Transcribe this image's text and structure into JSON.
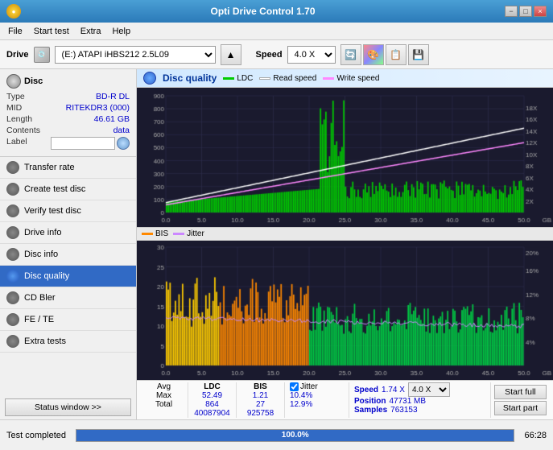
{
  "window": {
    "title": "Opti Drive Control 1.70",
    "icon": "disc-icon"
  },
  "titlebar": {
    "minimize_label": "−",
    "maximize_label": "□",
    "close_label": "×"
  },
  "menu": {
    "items": [
      "File",
      "Start test",
      "Extra",
      "Help"
    ]
  },
  "drive": {
    "label": "Drive",
    "value": "(E:)  ATAPI iHBS212  2.5L09",
    "speed_label": "Speed",
    "speed_value": "4.0 X"
  },
  "disc": {
    "header": "Disc",
    "type_label": "Type",
    "type_value": "BD-R DL",
    "mid_label": "MID",
    "mid_value": "RITEKDR3 (000)",
    "length_label": "Length",
    "length_value": "46.61 GB",
    "contents_label": "Contents",
    "contents_value": "data",
    "label_label": "Label",
    "label_value": ""
  },
  "nav": {
    "items": [
      {
        "id": "transfer-rate",
        "label": "Transfer rate",
        "active": false
      },
      {
        "id": "create-test",
        "label": "Create test disc",
        "active": false
      },
      {
        "id": "verify-test",
        "label": "Verify test disc",
        "active": false
      },
      {
        "id": "drive-info",
        "label": "Drive info",
        "active": false
      },
      {
        "id": "disc-info",
        "label": "Disc info",
        "active": false
      },
      {
        "id": "disc-quality",
        "label": "Disc quality",
        "active": true
      },
      {
        "id": "cd-bler",
        "label": "CD Bler",
        "active": false
      },
      {
        "id": "fe-te",
        "label": "FE / TE",
        "active": false
      },
      {
        "id": "extra-tests",
        "label": "Extra tests",
        "active": false
      }
    ]
  },
  "status_btn": "Status window >>",
  "chart": {
    "title": "Disc quality",
    "legend": [
      {
        "id": "ldc",
        "label": "LDC",
        "color": "#00aa00"
      },
      {
        "id": "read-speed",
        "label": "Read speed",
        "color": "#ffffff"
      },
      {
        "id": "write-speed",
        "label": "Write speed",
        "color": "#ff88ff"
      }
    ],
    "legend2": [
      {
        "id": "bis",
        "label": "BIS",
        "color": "#ff8800"
      },
      {
        "id": "jitter",
        "label": "Jitter",
        "color": "#cc88ff"
      }
    ]
  },
  "stats": {
    "headers": [
      "LDC",
      "BIS"
    ],
    "jitter_label": "Jitter",
    "jitter_checked": true,
    "speed_label": "Speed",
    "speed_value": "1.74 X",
    "speed_select": "4.0 X",
    "avg_label": "Avg",
    "avg_ldc": "52.49",
    "avg_bis": "1.21",
    "avg_jitter": "10.4%",
    "max_label": "Max",
    "max_ldc": "864",
    "max_bis": "27",
    "max_jitter": "12.9%",
    "total_label": "Total",
    "total_ldc": "40087904",
    "total_bis": "925758",
    "position_label": "Position",
    "position_value": "47731 MB",
    "samples_label": "Samples",
    "samples_value": "763153",
    "start_full": "Start full",
    "start_part": "Start part"
  },
  "statusbar": {
    "status_text": "Test completed",
    "progress": "100.0%",
    "progress_value": 100,
    "time": "66:28"
  }
}
